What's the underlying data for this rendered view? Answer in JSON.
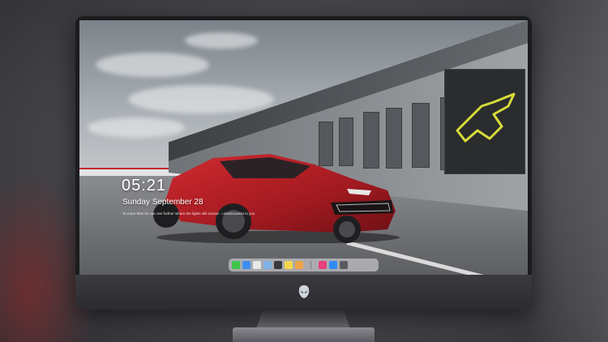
{
  "lock_screen": {
    "time": "05:21",
    "date": "Sunday September  28",
    "quote": "To more than he can see further where the lights still remain - unbeknownst to you"
  },
  "dock": {
    "apps_left": [
      {
        "icon": "messages-icon",
        "color": "#3ec74a"
      },
      {
        "icon": "finder-icon",
        "color": "#3d8ef0"
      },
      {
        "icon": "safari-icon",
        "color": "#e8e8ea"
      },
      {
        "icon": "preview-icon",
        "color": "#7fb2e6"
      },
      {
        "icon": "clapperboard-icon",
        "color": "#3a3a3c"
      },
      {
        "icon": "notes-icon",
        "color": "#f5d64a"
      },
      {
        "icon": "photos-icon",
        "color": "#f0a345"
      }
    ],
    "apps_right": [
      {
        "icon": "music-icon",
        "color": "#e8407a"
      },
      {
        "icon": "app-store-icon",
        "color": "#2f8df5"
      },
      {
        "icon": "camera-icon",
        "color": "#5a5a5e"
      }
    ]
  },
  "colors": {
    "car": "#b01c24",
    "monitor_frame": "#1c1c1f",
    "chin": "#333338"
  }
}
